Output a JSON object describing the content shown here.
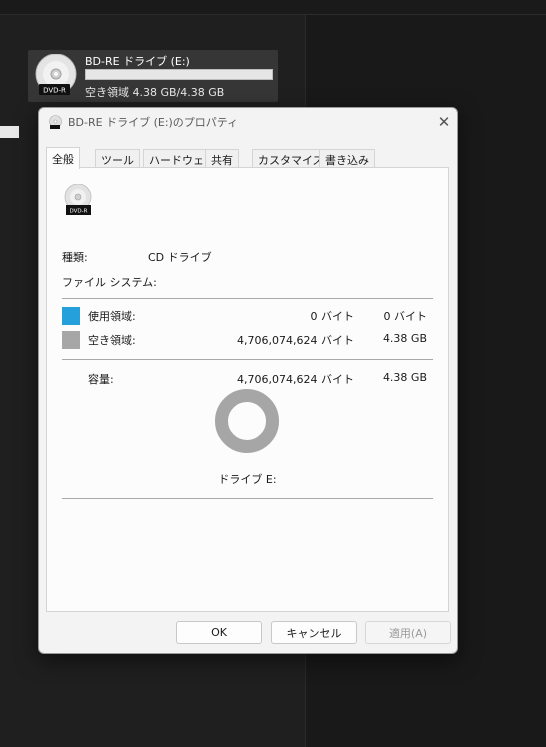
{
  "explorer": {
    "drive_name": "BD-RE ドライブ (E:)",
    "drive_free_text": "空き領域 4.38 GB/4.38 GB",
    "drive_used_fraction": 0,
    "disc_badge": "DVD-R"
  },
  "dialog": {
    "title": "BD-RE ドライブ (E:)のプロパティ",
    "close_icon": "close-icon",
    "tabs": [
      {
        "label": "全般",
        "active": true
      },
      {
        "label": "ツール",
        "active": false
      },
      {
        "label": "ハードウェア",
        "active": false
      },
      {
        "label": "共有",
        "active": false
      },
      {
        "label": "カスタマイズ",
        "active": false
      },
      {
        "label": "書き込み",
        "active": false
      }
    ],
    "general": {
      "disc_badge": "DVD-R",
      "type_label": "種類:",
      "type_value": "CD ドライブ",
      "fs_label": "ファイル システム:",
      "fs_value": "",
      "used": {
        "label": "使用領域:",
        "bytes": "0 バイト",
        "size": "0 バイト",
        "color": "#26a0da"
      },
      "free": {
        "label": "空き領域:",
        "bytes": "4,706,074,624 バイト",
        "size": "4.38 GB",
        "color": "#a6a6a6"
      },
      "capacity": {
        "label": "容量:",
        "bytes": "4,706,074,624 バイト",
        "size": "4.38 GB"
      },
      "used_fraction": 0,
      "drive_label": "ドライブ E:"
    },
    "buttons": {
      "ok": "OK",
      "cancel": "キャンセル",
      "apply": "適用(A)"
    }
  }
}
